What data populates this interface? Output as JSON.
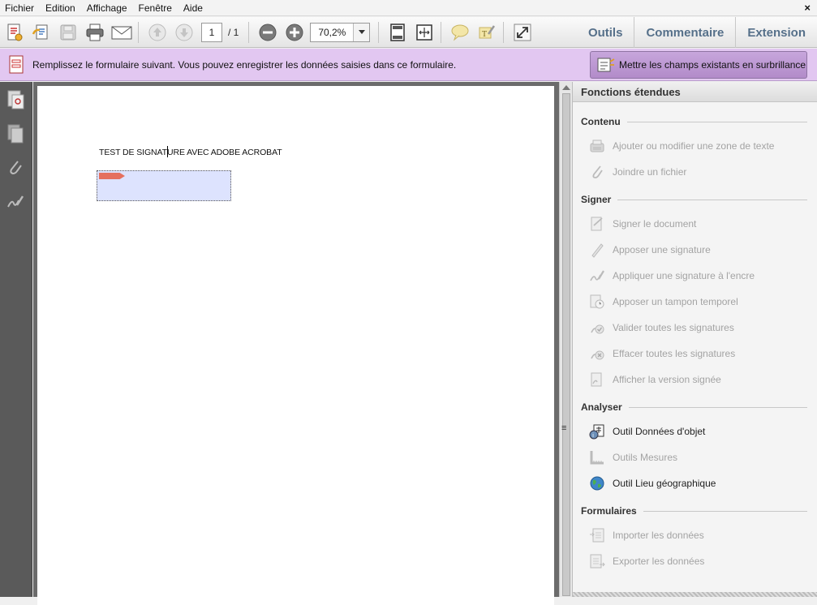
{
  "menu": {
    "items": [
      "Fichier",
      "Edition",
      "Affichage",
      "Fenêtre",
      "Aide"
    ],
    "close_label": "×"
  },
  "toolbar": {
    "page_current": "1",
    "page_total": "/ 1",
    "zoom": "70,2%",
    "links": [
      "Outils",
      "Commentaire",
      "Extension"
    ]
  },
  "formbar": {
    "message": "Remplissez le formulaire suivant. Vous pouvez enregistrer les données saisies dans ce formulaire.",
    "highlight_button": "Mettre les champs existants en surbrillance"
  },
  "document": {
    "title": "TEST DE SIGNATURE AVEC ADOBE ACROBAT"
  },
  "panel": {
    "header": "Fonctions étendues",
    "sections": [
      {
        "title": "Contenu",
        "items": [
          {
            "label": "Ajouter ou modifier une zone de texte",
            "icon": "typewriter-icon",
            "enabled": false
          },
          {
            "label": "Joindre un fichier",
            "icon": "paperclip-icon",
            "enabled": false
          }
        ]
      },
      {
        "title": "Signer",
        "items": [
          {
            "label": "Signer le document",
            "icon": "sign-document-icon",
            "enabled": false
          },
          {
            "label": "Apposer une signature",
            "icon": "pen-icon",
            "enabled": false
          },
          {
            "label": "Appliquer une signature à l'encre",
            "icon": "ink-signature-icon",
            "enabled": false
          },
          {
            "label": "Apposer un tampon temporel",
            "icon": "timestamp-icon",
            "enabled": false
          },
          {
            "label": "Valider toutes les signatures",
            "icon": "validate-signatures-icon",
            "enabled": false
          },
          {
            "label": "Effacer toutes les signatures",
            "icon": "clear-signatures-icon",
            "enabled": false
          },
          {
            "label": "Afficher la version signée",
            "icon": "signed-version-icon",
            "enabled": false
          }
        ]
      },
      {
        "title": "Analyser",
        "items": [
          {
            "label": "Outil Données d'objet",
            "icon": "object-data-icon",
            "enabled": true
          },
          {
            "label": "Outils Mesures",
            "icon": "ruler-icon",
            "enabled": false
          },
          {
            "label": "Outil Lieu géographique",
            "icon": "globe-icon",
            "enabled": true
          }
        ]
      },
      {
        "title": "Formulaires",
        "items": [
          {
            "label": "Importer les données",
            "icon": "import-data-icon",
            "enabled": false
          },
          {
            "label": "Exporter les données",
            "icon": "export-data-icon",
            "enabled": false
          }
        ]
      }
    ]
  },
  "colors": {
    "formbar_bg": "#e2c7f1",
    "link_text": "#56708a",
    "field_fill": "#dde3fe",
    "disabled_text": "#a3a3a3"
  }
}
